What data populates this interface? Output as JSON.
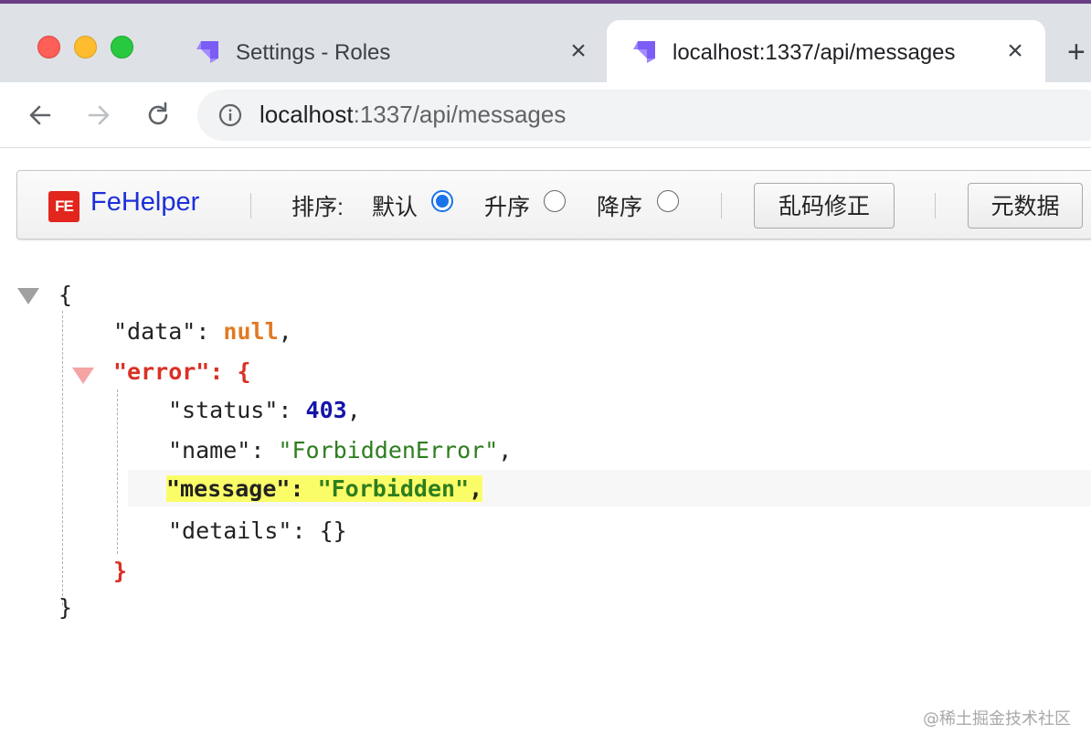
{
  "browser": {
    "tabs": [
      {
        "title": "Settings - Roles",
        "active": false
      },
      {
        "title": "localhost:1337/api/messages",
        "active": true
      }
    ],
    "new_tab_label": "+",
    "close_label": "×",
    "address": {
      "host": "localhost",
      "rest": ":1337/api/messages"
    }
  },
  "fehelper": {
    "logo_text": "FE",
    "brand": "FeHelper",
    "sort_label": "排序:",
    "sort_options": [
      {
        "label": "默认",
        "checked": true
      },
      {
        "label": "升序",
        "checked": false
      },
      {
        "label": "降序",
        "checked": false
      }
    ],
    "fix_encoding_button": "乱码修正",
    "metadata_button": "元数据"
  },
  "json_view": {
    "open_brace": "{",
    "close_brace": "}",
    "data_key": "\"data\"",
    "data_value": "null",
    "error_key": "\"error\"",
    "error_open": "{",
    "error_close": "}",
    "fields": [
      {
        "key": "\"status\"",
        "value": "403",
        "type": "number"
      },
      {
        "key": "\"name\"",
        "value": "\"ForbiddenError\"",
        "type": "string"
      },
      {
        "key": "\"message\"",
        "value": "\"Forbidden\"",
        "type": "string",
        "highlighted": true
      },
      {
        "key": "\"details\"",
        "value": "{}",
        "type": "object"
      }
    ]
  },
  "watermark": "@稀土掘金技术社区",
  "colors": {
    "string": "#2e7d1f",
    "number": "#1414a8",
    "null": "#e07a23",
    "highlight": "#fbfd68",
    "accent": "#1a73e8"
  }
}
